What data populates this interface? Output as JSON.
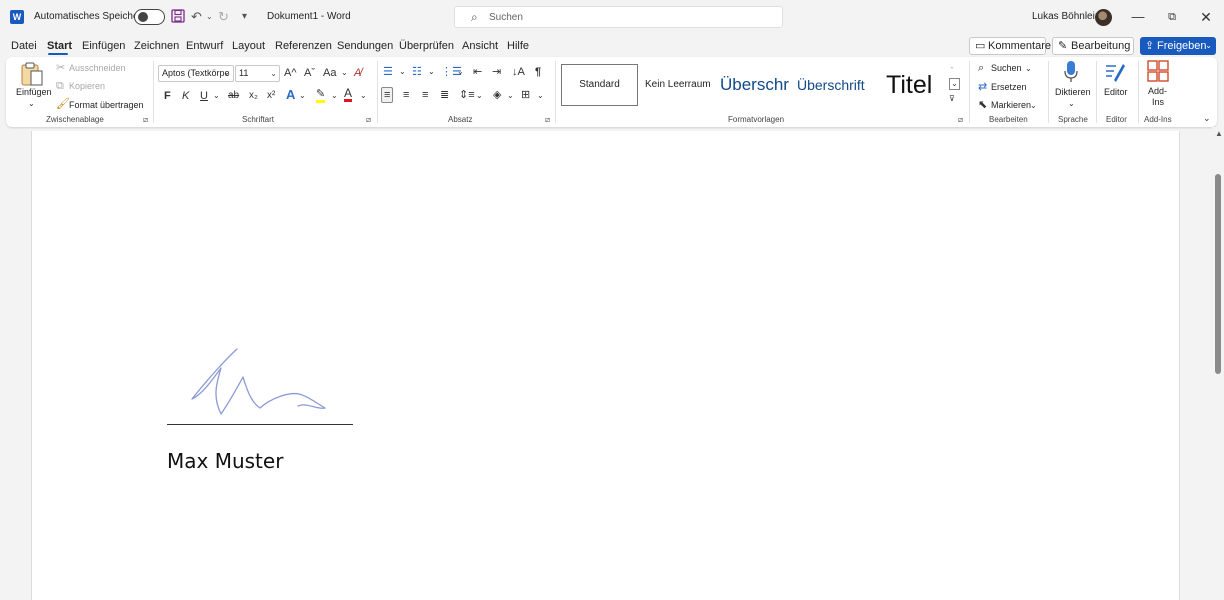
{
  "titlebar": {
    "app_badge": "W",
    "autosave_label": "Automatisches Speichern",
    "document_title": "Dokument1  -  Word",
    "search_placeholder": "Suchen",
    "user_name": "Lukas Böhnlein",
    "icons": [
      "word-icon",
      "save-icon",
      "undo-icon",
      "redo-icon",
      "customize-qat-icon",
      "search-icon",
      "minimize-icon",
      "restore-icon",
      "close-icon"
    ]
  },
  "menu": {
    "tabs": [
      "Datei",
      "Start",
      "Einfügen",
      "Zeichnen",
      "Entwurf",
      "Layout",
      "Referenzen",
      "Sendungen",
      "Überprüfen",
      "Ansicht",
      "Hilfe"
    ],
    "active_tab": "Start",
    "comments_label": "Kommentare",
    "editing_label": "Bearbeitung",
    "share_label": "Freigeben"
  },
  "ribbon": {
    "clipboard": {
      "paste_label": "Einfügen",
      "cut_label": "Ausschneiden",
      "copy_label": "Kopieren",
      "format_painter_label": "Format übertragen",
      "group_label": "Zwischenablage"
    },
    "font": {
      "font_name": "Aptos (Textkörpe",
      "font_size": "11",
      "bold": "F",
      "italic": "K",
      "underline": "U",
      "strikethrough": "ab",
      "grow": "A^",
      "shrink": "Aˇ",
      "case": "Aa",
      "group_label": "Schriftart"
    },
    "paragraph": {
      "show_marks": "¶",
      "group_label": "Absatz"
    },
    "styles": {
      "items": [
        "Standard",
        "Kein Leerraum",
        "Überschr",
        "Überschrift",
        "Titel"
      ],
      "group_label": "Formatvorlagen"
    },
    "editing": {
      "find_label": "Suchen",
      "replace_label": "Ersetzen",
      "select_label": "Markieren",
      "group_label": "Bearbeiten"
    },
    "voice": {
      "dictate_label": "Diktieren",
      "group_label": "Sprache"
    },
    "editor": {
      "editor_label": "Editor",
      "group_label": "Editor"
    },
    "addins": {
      "addins_label_line1": "Add-",
      "addins_label_line2": "Ins",
      "group_label": "Add-Ins"
    }
  },
  "document": {
    "signatory_name": "Max Muster"
  },
  "colors": {
    "accent": "#185abd",
    "signature_ink": "#8c9ad8",
    "highlight": "#ffff00",
    "font_color": "#e81123"
  }
}
